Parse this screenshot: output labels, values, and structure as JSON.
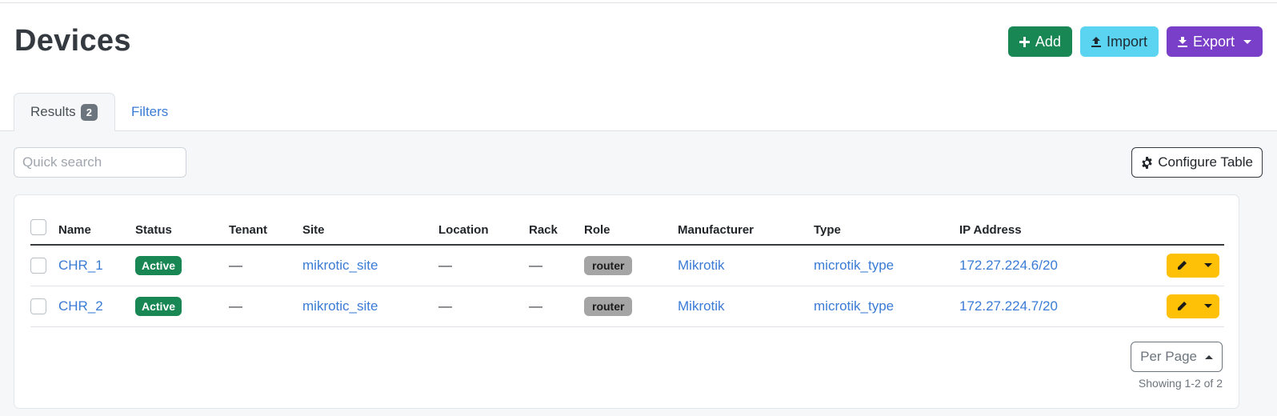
{
  "header": {
    "title": "Devices",
    "add_label": "Add",
    "import_label": "Import",
    "export_label": "Export"
  },
  "tabs": {
    "results_label": "Results",
    "results_count": "2",
    "filters_label": "Filters"
  },
  "toolbar": {
    "search_placeholder": "Quick search",
    "configure_label": "Configure Table"
  },
  "table": {
    "columns": [
      "Name",
      "Status",
      "Tenant",
      "Site",
      "Location",
      "Rack",
      "Role",
      "Manufacturer",
      "Type",
      "IP Address"
    ],
    "rows": [
      {
        "name": "CHR_1",
        "status": "Active",
        "tenant": "—",
        "site": "mikrotic_site",
        "location": "—",
        "rack": "—",
        "role": "router",
        "manufacturer": "Mikrotik",
        "type": "microtik_type",
        "ip": "172.27.224.6/20"
      },
      {
        "name": "CHR_2",
        "status": "Active",
        "tenant": "—",
        "site": "mikrotic_site",
        "location": "—",
        "rack": "—",
        "role": "router",
        "manufacturer": "Mikrotik",
        "type": "microtik_type",
        "ip": "172.27.224.7/20"
      }
    ]
  },
  "pagination": {
    "per_page_label": "Per Page",
    "showing": "Showing 1-2 of 2"
  },
  "colors": {
    "add": "#198754",
    "import": "#5bd4f2",
    "export": "#7a3fc8",
    "status_active": "#198754",
    "role": "#a5a5a5",
    "row_action": "#ffc107",
    "link": "#3a7bd5"
  },
  "icons": {
    "add": "plus-icon",
    "import": "upload-icon",
    "export": "download-icon",
    "configure": "gear-icon",
    "edit": "pencil-icon"
  }
}
